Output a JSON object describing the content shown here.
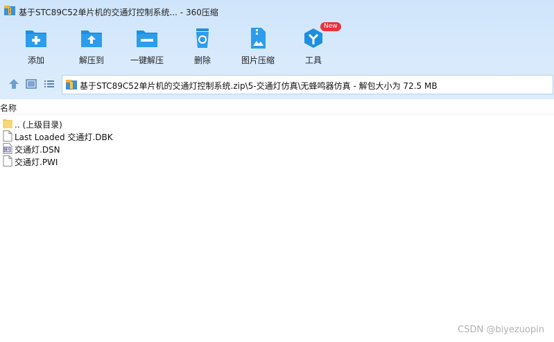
{
  "window": {
    "title": "基于STC89C52单片机的交通灯控制系统... - 360压缩"
  },
  "toolbar": {
    "items": [
      {
        "label": "添加",
        "icon": "add-folder-icon"
      },
      {
        "label": "解压到",
        "icon": "extract-to-icon"
      },
      {
        "label": "一键解压",
        "icon": "one-click-extract-icon"
      },
      {
        "label": "删除",
        "icon": "recycle-bin-icon"
      },
      {
        "label": "图片压缩",
        "icon": "image-compress-icon"
      },
      {
        "label": "工具",
        "icon": "tools-icon",
        "badge": "New"
      }
    ]
  },
  "nav": {
    "path": "基于STC89C52单片机的交通灯控制系统.zip\\5-交通灯仿真\\无蜂鸣器仿真 - 解包大小为 72.5 MB"
  },
  "list": {
    "column_name": "名称",
    "rows": [
      {
        "name": ".. (上级目录)",
        "icon": "folder-icon"
      },
      {
        "name": "Last Loaded 交通灯.DBK",
        "icon": "file-icon"
      },
      {
        "name": "交通灯.DSN",
        "icon": "dsn-file-icon"
      },
      {
        "name": "交通灯.PWI",
        "icon": "file-icon"
      }
    ]
  },
  "watermark": "CSDN @biyezuopin",
  "colors": {
    "accent": "#1e8fe0",
    "band": "#d8eafc"
  }
}
